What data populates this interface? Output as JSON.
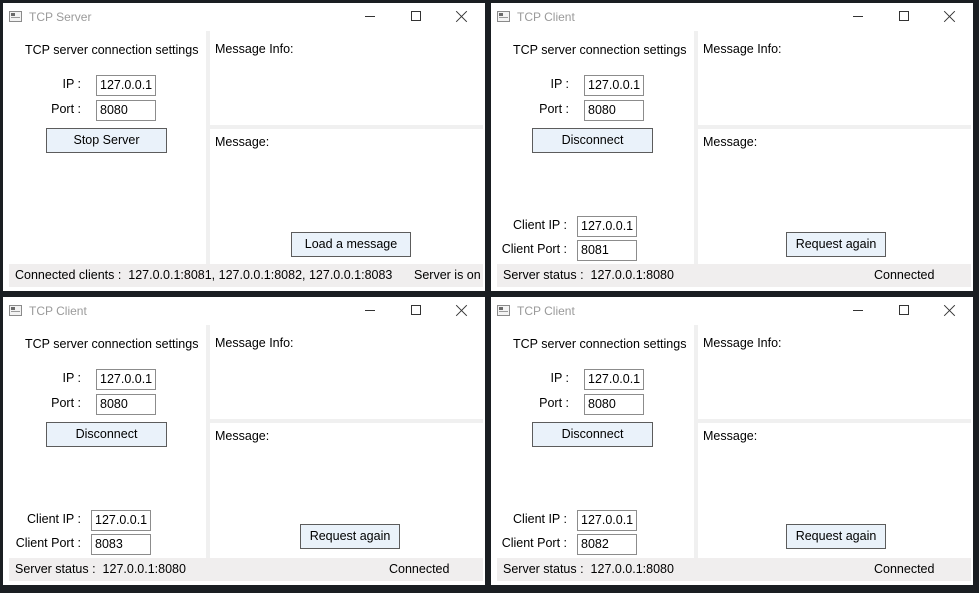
{
  "windows": [
    {
      "title": "TCP Server",
      "settings_title": "TCP server connection settings",
      "ip_label": "IP :",
      "ip_value": "127.0.0.1",
      "port_label": "Port :",
      "port_value": "8080",
      "main_button": "Stop Server",
      "message_info_label": "Message Info:",
      "message_label": "Message:",
      "action_button": "Load a message",
      "status_label": "Connected clients :",
      "status_value": "127.0.0.1:8081, 127.0.0.1:8082, 127.0.0.1:8083",
      "status_right": "Server is on"
    },
    {
      "title": "TCP Client",
      "settings_title": "TCP server connection settings",
      "ip_label": "IP :",
      "ip_value": "127.0.0.1",
      "port_label": "Port :",
      "port_value": "8080",
      "main_button": "Disconnect",
      "client_ip_label": "Client IP :",
      "client_ip_value": "127.0.0.1",
      "client_port_label": "Client Port :",
      "client_port_value": "8081",
      "message_info_label": "Message Info:",
      "message_label": "Message:",
      "action_button": "Request again",
      "status_label": "Server status :",
      "status_value": "127.0.0.1:8080",
      "status_right": "Connected"
    },
    {
      "title": "TCP Client",
      "settings_title": "TCP server connection settings",
      "ip_label": "IP :",
      "ip_value": "127.0.0.1",
      "port_label": "Port :",
      "port_value": "8080",
      "main_button": "Disconnect",
      "client_ip_label": "Client IP :",
      "client_ip_value": "127.0.0.1",
      "client_port_label": "Client Port :",
      "client_port_value": "8083",
      "message_info_label": "Message Info:",
      "message_label": "Message:",
      "action_button": "Request again",
      "status_label": "Server status :",
      "status_value": "127.0.0.1:8080",
      "status_right": "Connected"
    },
    {
      "title": "TCP Client",
      "settings_title": "TCP server connection settings",
      "ip_label": "IP :",
      "ip_value": "127.0.0.1",
      "port_label": "Port :",
      "port_value": "8080",
      "main_button": "Disconnect",
      "client_ip_label": "Client IP :",
      "client_ip_value": "127.0.0.1",
      "client_port_label": "Client Port :",
      "client_port_value": "8082",
      "message_info_label": "Message Info:",
      "message_label": "Message:",
      "action_button": "Request again",
      "status_label": "Server status :",
      "status_value": "127.0.0.1:8080",
      "status_right": "Connected"
    }
  ]
}
